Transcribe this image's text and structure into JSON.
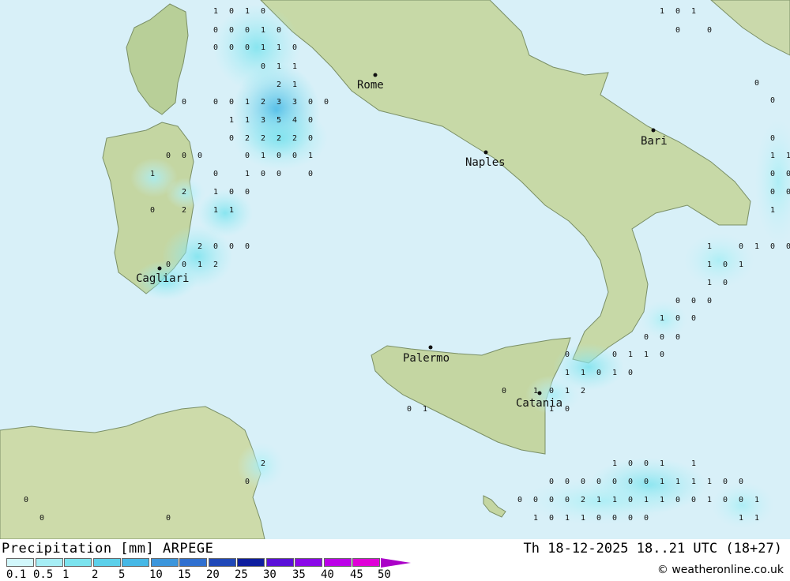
{
  "map": {
    "cities": [
      {
        "name": "Rome"
      },
      {
        "name": "Naples"
      },
      {
        "name": "Bari"
      },
      {
        "name": "Cagliari"
      },
      {
        "name": "Palermo"
      },
      {
        "name": "Catania"
      }
    ],
    "precip_values": [
      "1",
      "0",
      "1",
      "0",
      "1",
      "0",
      "1",
      "0",
      "0",
      "0",
      "1",
      "0",
      "0",
      "0",
      "0",
      "1",
      "1",
      "0",
      "0",
      "1",
      "1",
      "2",
      "1",
      "0",
      "0",
      "0",
      "1",
      "2",
      "3",
      "3",
      "0",
      "0",
      "1",
      "1",
      "3",
      "5",
      "4",
      "0",
      "0",
      "2",
      "2",
      "2",
      "2",
      "0",
      "0",
      "0",
      "0",
      "0",
      "1",
      "0",
      "0",
      "1",
      "1",
      "0",
      "1",
      "0",
      "0",
      "0",
      "2",
      "1",
      "0",
      "0",
      "0",
      "1",
      "1",
      "1",
      "1",
      "0",
      "0",
      "0",
      "0",
      "2",
      "0",
      "0",
      "0",
      "0",
      "0",
      "1",
      "2",
      "2",
      "1",
      "0",
      "1",
      "1",
      "1",
      "0",
      "1",
      "0",
      "0",
      "0",
      "0",
      "0",
      "0",
      "1",
      "0",
      "0",
      "0",
      "0",
      "0",
      "0",
      "0",
      "1",
      "1",
      "0",
      "1",
      "0",
      "0",
      "1",
      "1",
      "0",
      "1",
      "0",
      "0",
      "1",
      "0",
      "1",
      "2",
      "1",
      "0",
      "0",
      "1",
      "2",
      "0",
      "1",
      "0",
      "0",
      "1",
      "1",
      "0",
      "0",
      "0",
      "0",
      "0",
      "0",
      "0",
      "1",
      "1",
      "1",
      "1",
      "0",
      "0",
      "0",
      "0",
      "0",
      "0",
      "2",
      "1",
      "1",
      "0",
      "1",
      "1",
      "0",
      "0",
      "1",
      "0",
      "0",
      "1",
      "1",
      "1",
      "0",
      "1",
      "1",
      "0",
      "0",
      "0",
      "0",
      "1",
      "0",
      "0",
      "0",
      "0",
      "0",
      "0",
      "0",
      "0",
      "0",
      "0",
      "1",
      "0",
      "0",
      "0",
      "0",
      "0"
    ]
  },
  "footer": {
    "title": "Precipitation [mm] ARPEGE",
    "datetime": "Th 18-12-2025 18..21 UTC (18+27)",
    "credit": "© weatheronline.co.uk",
    "scale": {
      "ticks": [
        "0.1",
        "0.5",
        "1",
        "2",
        "5",
        "10",
        "15",
        "20",
        "25",
        "30",
        "35",
        "40",
        "45",
        "50"
      ],
      "colors": [
        "#d2f7fb",
        "#a6eef5",
        "#7be3ee",
        "#5cd0ea",
        "#46b8e6",
        "#3c96dc",
        "#3070d0",
        "#2048b8",
        "#0e1e9e",
        "#5a10d8",
        "#8a08e8",
        "#bc00e8",
        "#e000d8",
        "#b800b0"
      ],
      "arrow_color": "#ab00c8"
    }
  }
}
